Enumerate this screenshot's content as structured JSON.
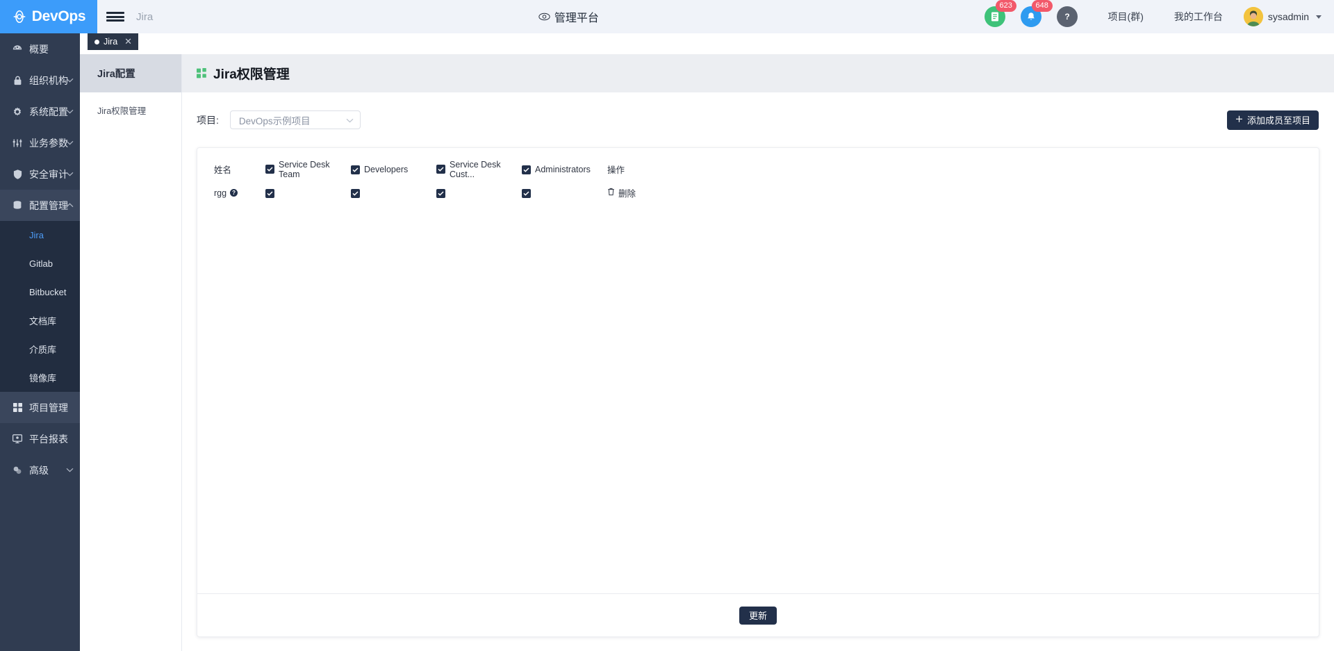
{
  "brand": {
    "name": "DevOps",
    "logo_icon": "devops-logo-icon"
  },
  "topbar": {
    "menu_icon": "hamburger-icon",
    "app_name": "Jira",
    "center_title": "管理平台",
    "center_icon": "eye-icon",
    "doc_icon": "document-icon",
    "doc_badge": "623",
    "bell_icon": "bell-icon",
    "bell_badge": "648",
    "help_icon": "question-mark-icon",
    "links": [
      {
        "label": "项目(群)"
      },
      {
        "label": "我的工作台"
      }
    ],
    "user": {
      "name": "sysadmin",
      "avatar_icon": "user-avatar"
    }
  },
  "sidebar": {
    "items": [
      {
        "label": "概要",
        "icon": "dashboard-icon",
        "chevron": false,
        "active": false
      },
      {
        "label": "组织机构",
        "icon": "lock-icon",
        "chevron": "down",
        "active": false
      },
      {
        "label": "系统配置",
        "icon": "gear-icon",
        "chevron": "down",
        "active": false
      },
      {
        "label": "业务参数",
        "icon": "sliders-icon",
        "chevron": "down",
        "active": false
      },
      {
        "label": "安全审计",
        "icon": "shield-icon",
        "chevron": "down",
        "active": false
      },
      {
        "label": "配置管理",
        "icon": "database-icon",
        "chevron": "up",
        "active": true
      }
    ],
    "sub_items": [
      {
        "label": "Jira",
        "selected": true
      },
      {
        "label": "Gitlab",
        "selected": false
      },
      {
        "label": "Bitbucket",
        "selected": false
      },
      {
        "label": "文档库",
        "selected": false
      },
      {
        "label": "介质库",
        "selected": false
      },
      {
        "label": "镜像库",
        "selected": false
      }
    ],
    "items_after": [
      {
        "label": "项目管理",
        "icon": "grid-icon",
        "chevron": false,
        "active": true
      },
      {
        "label": "平台报表",
        "icon": "monitor-icon",
        "chevron": false,
        "active": false
      },
      {
        "label": "高级",
        "icon": "settings-advanced-icon",
        "chevron": "down",
        "active": false
      }
    ]
  },
  "tabs": [
    {
      "label": "Jira",
      "active": true,
      "closable": true
    }
  ],
  "subnav": {
    "title": "Jira配置",
    "items": [
      {
        "label": "Jira权限管理",
        "selected": true
      }
    ]
  },
  "page": {
    "title": "Jira权限管理",
    "title_icon": "green-grid-icon",
    "project_label": "项目:",
    "project_selected": "DevOps示例项目",
    "project_chevron_icon": "chevron-down-icon",
    "add_member_button": "添加成员至项目",
    "add_member_icon": "plus-icon",
    "update_button": "更新"
  },
  "table": {
    "headers": [
      {
        "label": "姓名",
        "checkbox": false
      },
      {
        "label": "Service Desk Team",
        "checkbox": true,
        "checked": true
      },
      {
        "label": "Developers",
        "checkbox": true,
        "checked": true
      },
      {
        "label": "Service Desk Cust...",
        "checkbox": true,
        "checked": true
      },
      {
        "label": "Administrators",
        "checkbox": true,
        "checked": true
      },
      {
        "label": "操作",
        "checkbox": false
      }
    ],
    "rows": [
      {
        "name": "rgg",
        "help_icon": "question-circle-icon",
        "checks": [
          true,
          true,
          true,
          true
        ],
        "action_label": "删除",
        "action_icon": "trash-icon"
      }
    ]
  },
  "colors": {
    "brand_blue": "#3c9cfa",
    "sidebar_dark": "#303c51",
    "sidebar_sub_dark": "#222d40",
    "accent_link": "#4d9bf5",
    "button_dark": "#22304a",
    "badge_red": "#f2596a",
    "green": "#3ec279",
    "title_green": "#4ec17a"
  }
}
